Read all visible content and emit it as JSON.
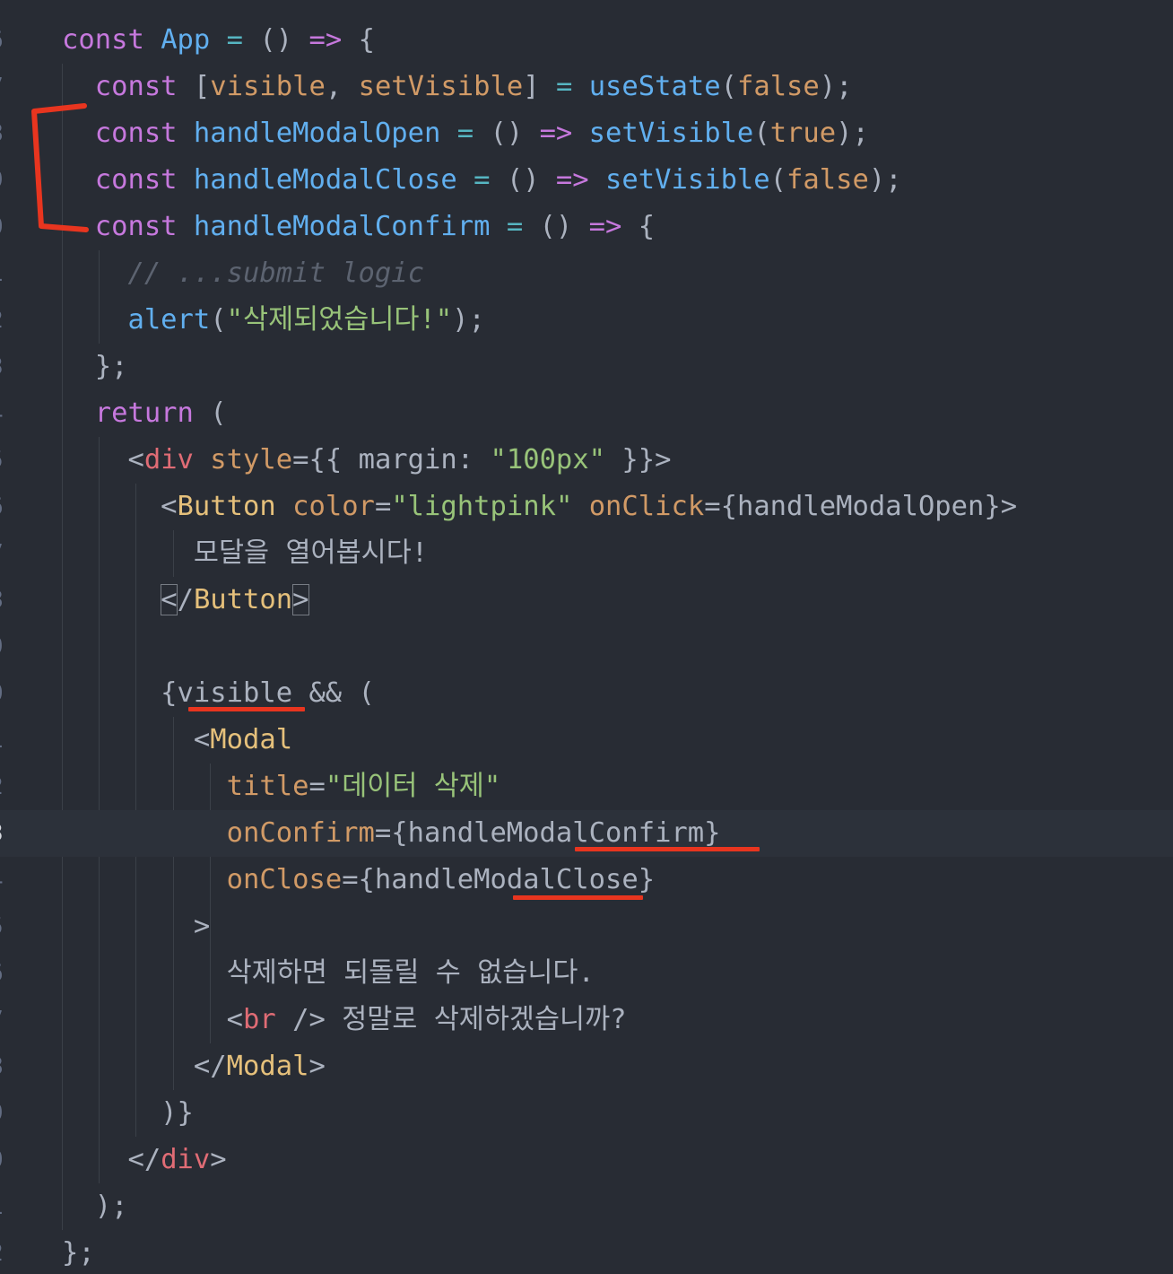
{
  "editor": {
    "theme_colors": {
      "background": "#282c34",
      "keyword": "#c678dd",
      "function": "#61afef",
      "string": "#98c379",
      "attribute": "#d19a66",
      "component": "#e5c07b",
      "html_tag": "#e06c75",
      "annotation": "#e8351f"
    },
    "active_line": 18,
    "lines": [
      {
        "n": "6",
        "tokens": [
          [
            "kw",
            "const "
          ],
          [
            "fn",
            "App"
          ],
          [
            "op",
            " = "
          ],
          [
            "pun",
            "() "
          ],
          [
            "kw",
            "=>"
          ],
          [
            "pun",
            " {"
          ]
        ]
      },
      {
        "n": "7",
        "tokens": [
          [
            "pun",
            "  "
          ],
          [
            "kw",
            "const "
          ],
          [
            "pun",
            "["
          ],
          [
            "attr",
            "visible"
          ],
          [
            "pun",
            ", "
          ],
          [
            "attr",
            "setVisible"
          ],
          [
            "pun",
            "] "
          ],
          [
            "op",
            "= "
          ],
          [
            "fn",
            "useState"
          ],
          [
            "pun",
            "("
          ],
          [
            "num",
            "false"
          ],
          [
            "pun",
            ");"
          ]
        ]
      },
      {
        "n": "8",
        "tokens": [
          [
            "pun",
            "  "
          ],
          [
            "kw",
            "const "
          ],
          [
            "fn",
            "handleModalOpen"
          ],
          [
            "op",
            " = "
          ],
          [
            "pun",
            "() "
          ],
          [
            "kw",
            "=>"
          ],
          [
            "pun",
            " "
          ],
          [
            "fn",
            "setVisible"
          ],
          [
            "pun",
            "("
          ],
          [
            "num",
            "true"
          ],
          [
            "pun",
            ");"
          ]
        ]
      },
      {
        "n": "9",
        "tokens": [
          [
            "pun",
            "  "
          ],
          [
            "kw",
            "const "
          ],
          [
            "fn",
            "handleModalClose"
          ],
          [
            "op",
            " = "
          ],
          [
            "pun",
            "() "
          ],
          [
            "kw",
            "=>"
          ],
          [
            "pun",
            " "
          ],
          [
            "fn",
            "setVisible"
          ],
          [
            "pun",
            "("
          ],
          [
            "num",
            "false"
          ],
          [
            "pun",
            ");"
          ]
        ]
      },
      {
        "n": "0",
        "tokens": [
          [
            "pun",
            "  "
          ],
          [
            "kw",
            "const "
          ],
          [
            "fn",
            "handleModalConfirm"
          ],
          [
            "op",
            " = "
          ],
          [
            "pun",
            "() "
          ],
          [
            "kw",
            "=>"
          ],
          [
            "pun",
            " {"
          ]
        ]
      },
      {
        "n": "1",
        "tokens": [
          [
            "pun",
            "    "
          ],
          [
            "cmt",
            "// ...submit logic"
          ]
        ]
      },
      {
        "n": "2",
        "tokens": [
          [
            "pun",
            "    "
          ],
          [
            "fn",
            "alert"
          ],
          [
            "pun",
            "("
          ],
          [
            "str",
            "\"삭제되었습니다!\""
          ],
          [
            "pun",
            ");"
          ]
        ]
      },
      {
        "n": "3",
        "tokens": [
          [
            "pun",
            "  };"
          ]
        ]
      },
      {
        "n": "4",
        "tokens": [
          [
            "pun",
            "  "
          ],
          [
            "kw",
            "return"
          ],
          [
            "pun",
            " ("
          ]
        ]
      },
      {
        "n": "5",
        "tokens": [
          [
            "pun",
            "    <"
          ],
          [
            "tagname-html",
            "div"
          ],
          [
            "pun",
            " "
          ],
          [
            "attr",
            "style"
          ],
          [
            "pun",
            "={{ margin: "
          ],
          [
            "str",
            "\"100px\""
          ],
          [
            "pun",
            " }}>"
          ]
        ]
      },
      {
        "n": "6",
        "tokens": [
          [
            "pun",
            "      <"
          ],
          [
            "tagname-comp",
            "Button"
          ],
          [
            "pun",
            " "
          ],
          [
            "attr",
            "color"
          ],
          [
            "pun",
            "="
          ],
          [
            "str",
            "\"lightpink\""
          ],
          [
            "pun",
            " "
          ],
          [
            "attr",
            "onClick"
          ],
          [
            "pun",
            "={handleModalOpen}>"
          ]
        ]
      },
      {
        "n": "7",
        "tokens": [
          [
            "pun",
            "        "
          ],
          [
            "txt",
            "모달을 열어봅시다!"
          ]
        ]
      },
      {
        "n": "8",
        "tokens": [
          [
            "pun",
            "      "
          ],
          [
            "bm",
            "<"
          ],
          [
            "pun",
            "/"
          ],
          [
            "tagname-comp",
            "Button"
          ],
          [
            "bm",
            ">"
          ]
        ]
      },
      {
        "n": "9",
        "tokens": [
          [
            "pun",
            ""
          ]
        ]
      },
      {
        "n": "0",
        "tokens": [
          [
            "pun",
            "      {visible && ("
          ]
        ]
      },
      {
        "n": "1",
        "tokens": [
          [
            "pun",
            "        <"
          ],
          [
            "tagname-comp",
            "Modal"
          ]
        ]
      },
      {
        "n": "2",
        "tokens": [
          [
            "pun",
            "          "
          ],
          [
            "attr",
            "title"
          ],
          [
            "pun",
            "="
          ],
          [
            "str",
            "\"데이터 삭제\""
          ]
        ]
      },
      {
        "n": "3",
        "tokens": [
          [
            "pun",
            "          "
          ],
          [
            "attr",
            "onConfirm"
          ],
          [
            "pun",
            "={handleModalConfirm}"
          ]
        ]
      },
      {
        "n": "4",
        "tokens": [
          [
            "pun",
            "          "
          ],
          [
            "attr",
            "onClose"
          ],
          [
            "pun",
            "={handleModalClose}"
          ]
        ]
      },
      {
        "n": "5",
        "tokens": [
          [
            "pun",
            "        >"
          ]
        ]
      },
      {
        "n": "6",
        "tokens": [
          [
            "pun",
            "          "
          ],
          [
            "txt",
            "삭제하면 되돌릴 수 없습니다."
          ]
        ]
      },
      {
        "n": "7",
        "tokens": [
          [
            "pun",
            "          <"
          ],
          [
            "tagname-html",
            "br"
          ],
          [
            "pun",
            " /> "
          ],
          [
            "txt",
            "정말로 삭제하겠습니까?"
          ]
        ]
      },
      {
        "n": "8",
        "tokens": [
          [
            "pun",
            "        </"
          ],
          [
            "tagname-comp",
            "Modal"
          ],
          [
            "pun",
            ">"
          ]
        ]
      },
      {
        "n": "9",
        "tokens": [
          [
            "pun",
            "      )}"
          ]
        ]
      },
      {
        "n": "0",
        "tokens": [
          [
            "pun",
            "    </"
          ],
          [
            "tagname-html",
            "div"
          ],
          [
            "pun",
            ">"
          ]
        ]
      },
      {
        "n": "1",
        "tokens": [
          [
            "pun",
            "  );"
          ]
        ]
      },
      {
        "n": "2",
        "tokens": [
          [
            "pun",
            "};"
          ]
        ]
      }
    ]
  }
}
